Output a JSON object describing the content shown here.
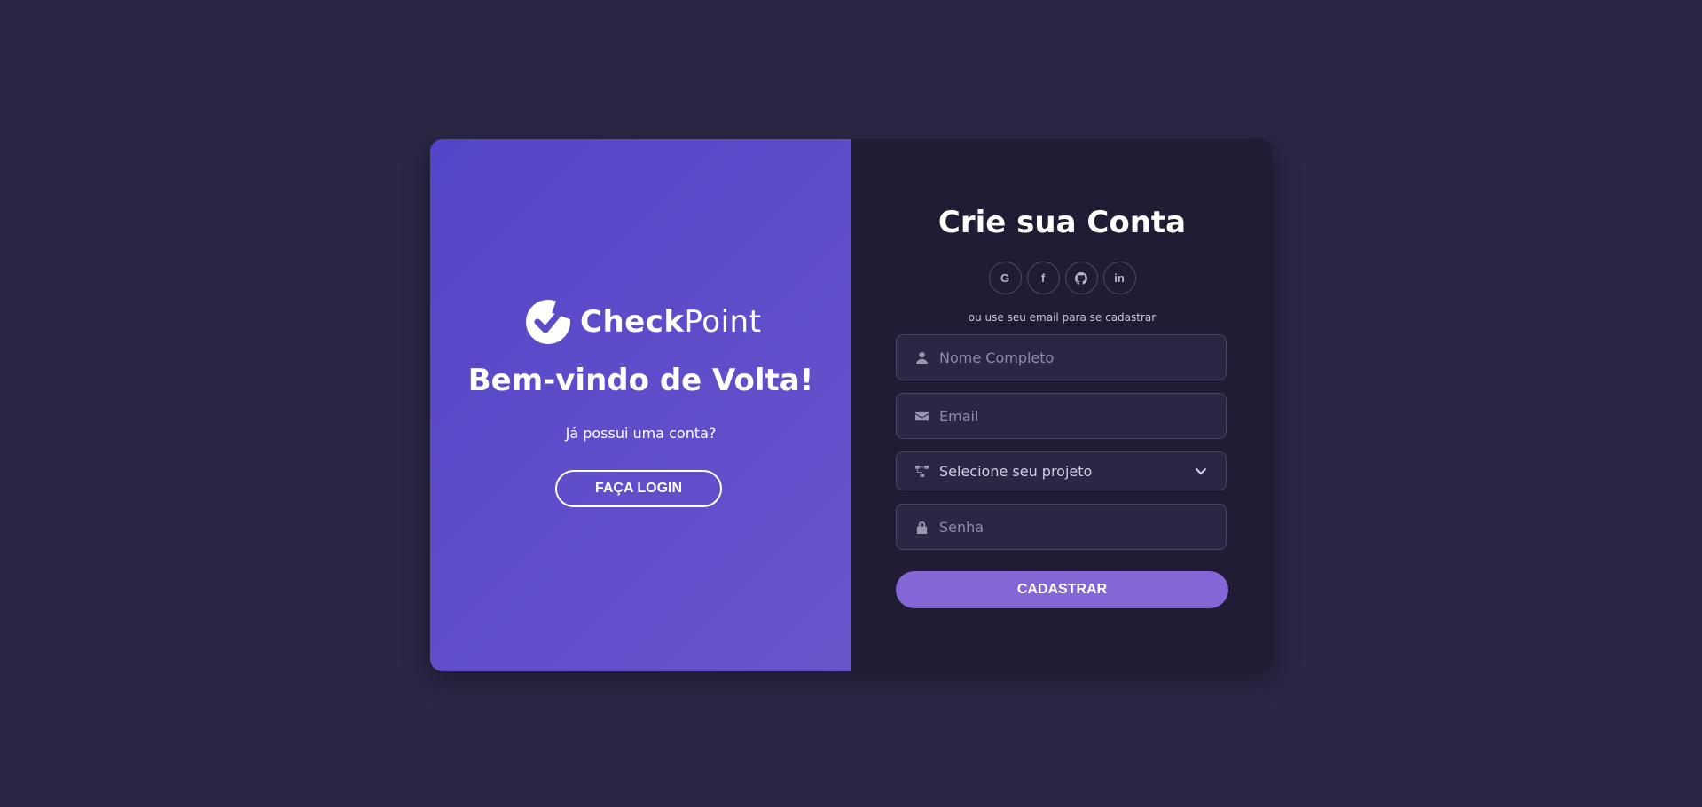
{
  "brand": {
    "name_bold": "Check",
    "name_light": "Point",
    "icon": "check-logo-icon"
  },
  "welcome": {
    "title": "Bem-vindo de Volta!",
    "subtitle": "Já possui uma conta?",
    "login_label": "FAÇA LOGIN"
  },
  "signup": {
    "title": "Crie sua Conta",
    "socials": [
      {
        "name": "google",
        "icon": "google-icon",
        "glyph": "G"
      },
      {
        "name": "facebook",
        "icon": "facebook-icon",
        "glyph": "f"
      },
      {
        "name": "github",
        "icon": "github-icon",
        "glyph": ""
      },
      {
        "name": "linkedin",
        "icon": "linkedin-icon",
        "glyph": "in"
      }
    ],
    "email_note": "ou use seu email para se cadastrar",
    "fields": {
      "name_placeholder": "Nome Completo",
      "email_placeholder": "Email",
      "project_value": "Selecione seu projeto",
      "password_placeholder": "Senha"
    },
    "submit_label": "CADASTRAR"
  },
  "colors": {
    "background": "#2a2745",
    "left_panel_start": "#5346c8",
    "left_panel_end": "#6a55cc",
    "right_panel": "#201c33",
    "accent_button": "#8566d6"
  }
}
